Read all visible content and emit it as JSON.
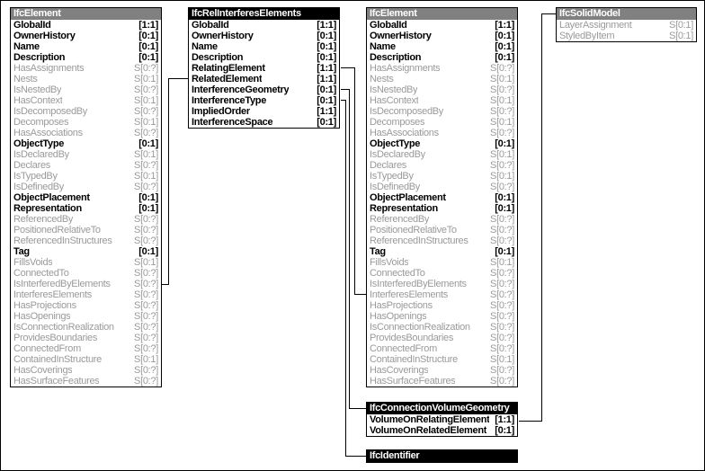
{
  "diagram": {
    "title": "IfcRelInterferesElements EXPRESS-G diagram",
    "cardinality_direct": "[1:1]",
    "colors": {
      "title_supertype": "#808080",
      "title_entity": "#000000",
      "direct_attribute": "#000000",
      "inverse_attribute": "#9a9a9a",
      "line": "#000000",
      "background": "#ffffff"
    }
  },
  "entities": {
    "ifc_element_left": {
      "name": "IfcElement",
      "title_style": "gray",
      "attributes": [
        {
          "name": "GlobalId",
          "card": "[1:1]",
          "kind": "direct"
        },
        {
          "name": "OwnerHistory",
          "card": "[0:1]",
          "kind": "direct"
        },
        {
          "name": "Name",
          "card": "[0:1]",
          "kind": "direct"
        },
        {
          "name": "Description",
          "card": "[0:1]",
          "kind": "direct"
        },
        {
          "name": "HasAssignments",
          "card": "S[0:?]",
          "kind": "inverse"
        },
        {
          "name": "Nests",
          "card": "S[0:1]",
          "kind": "inverse"
        },
        {
          "name": "IsNestedBy",
          "card": "S[0:?]",
          "kind": "inverse"
        },
        {
          "name": "HasContext",
          "card": "S[0:1]",
          "kind": "inverse"
        },
        {
          "name": "IsDecomposedBy",
          "card": "S[0:?]",
          "kind": "inverse"
        },
        {
          "name": "Decomposes",
          "card": "S[0:1]",
          "kind": "inverse"
        },
        {
          "name": "HasAssociations",
          "card": "S[0:?]",
          "kind": "inverse"
        },
        {
          "name": "ObjectType",
          "card": "[0:1]",
          "kind": "direct"
        },
        {
          "name": "IsDeclaredBy",
          "card": "S[0:1]",
          "kind": "inverse"
        },
        {
          "name": "Declares",
          "card": "S[0:?]",
          "kind": "inverse"
        },
        {
          "name": "IsTypedBy",
          "card": "S[0:1]",
          "kind": "inverse"
        },
        {
          "name": "IsDefinedBy",
          "card": "S[0:?]",
          "kind": "inverse"
        },
        {
          "name": "ObjectPlacement",
          "card": "[0:1]",
          "kind": "direct"
        },
        {
          "name": "Representation",
          "card": "[0:1]",
          "kind": "direct"
        },
        {
          "name": "ReferencedBy",
          "card": "S[0:?]",
          "kind": "inverse"
        },
        {
          "name": "PositionedRelativeTo",
          "card": "S[0:?]",
          "kind": "inverse"
        },
        {
          "name": "ReferencedInStructures",
          "card": "S[0:?]",
          "kind": "inverse"
        },
        {
          "name": "Tag",
          "card": "[0:1]",
          "kind": "direct"
        },
        {
          "name": "FillsVoids",
          "card": "S[0:1]",
          "kind": "inverse"
        },
        {
          "name": "ConnectedTo",
          "card": "S[0:?]",
          "kind": "inverse"
        },
        {
          "name": "IsInterferedByElements",
          "card": "S[0:?]",
          "kind": "inverse"
        },
        {
          "name": "InterferesElements",
          "card": "S[0:?]",
          "kind": "inverse"
        },
        {
          "name": "HasProjections",
          "card": "S[0:?]",
          "kind": "inverse"
        },
        {
          "name": "HasOpenings",
          "card": "S[0:?]",
          "kind": "inverse"
        },
        {
          "name": "IsConnectionRealization",
          "card": "S[0:?]",
          "kind": "inverse"
        },
        {
          "name": "ProvidesBoundaries",
          "card": "S[0:?]",
          "kind": "inverse"
        },
        {
          "name": "ConnectedFrom",
          "card": "S[0:?]",
          "kind": "inverse"
        },
        {
          "name": "ContainedInStructure",
          "card": "S[0:1]",
          "kind": "inverse"
        },
        {
          "name": "HasCoverings",
          "card": "S[0:?]",
          "kind": "inverse"
        },
        {
          "name": "HasSurfaceFeatures",
          "card": "S[0:?]",
          "kind": "inverse"
        }
      ]
    },
    "ifc_rel_interferes_elements": {
      "name": "IfcRelInterferesElements",
      "title_style": "black",
      "attributes": [
        {
          "name": "GlobalId",
          "card": "[1:1]",
          "kind": "direct"
        },
        {
          "name": "OwnerHistory",
          "card": "[0:1]",
          "kind": "direct"
        },
        {
          "name": "Name",
          "card": "[0:1]",
          "kind": "direct"
        },
        {
          "name": "Description",
          "card": "[0:1]",
          "kind": "direct"
        },
        {
          "name": "RelatingElement",
          "card": "[1:1]",
          "kind": "direct"
        },
        {
          "name": "RelatedElement",
          "card": "[1:1]",
          "kind": "direct"
        },
        {
          "name": "InterferenceGeometry",
          "card": "[0:1]",
          "kind": "direct"
        },
        {
          "name": "InterferenceType",
          "card": "[0:1]",
          "kind": "direct"
        },
        {
          "name": "ImpliedOrder",
          "card": "[1:1]",
          "kind": "direct"
        },
        {
          "name": "InterferenceSpace",
          "card": "[0:1]",
          "kind": "direct"
        }
      ]
    },
    "ifc_element_right": {
      "name": "IfcElement",
      "title_style": "gray",
      "attributes": [
        {
          "name": "GlobalId",
          "card": "[1:1]",
          "kind": "direct"
        },
        {
          "name": "OwnerHistory",
          "card": "[0:1]",
          "kind": "direct"
        },
        {
          "name": "Name",
          "card": "[0:1]",
          "kind": "direct"
        },
        {
          "name": "Description",
          "card": "[0:1]",
          "kind": "direct"
        },
        {
          "name": "HasAssignments",
          "card": "S[0:?]",
          "kind": "inverse"
        },
        {
          "name": "Nests",
          "card": "S[0:1]",
          "kind": "inverse"
        },
        {
          "name": "IsNestedBy",
          "card": "S[0:?]",
          "kind": "inverse"
        },
        {
          "name": "HasContext",
          "card": "S[0:1]",
          "kind": "inverse"
        },
        {
          "name": "IsDecomposedBy",
          "card": "S[0:?]",
          "kind": "inverse"
        },
        {
          "name": "Decomposes",
          "card": "S[0:1]",
          "kind": "inverse"
        },
        {
          "name": "HasAssociations",
          "card": "S[0:?]",
          "kind": "inverse"
        },
        {
          "name": "ObjectType",
          "card": "[0:1]",
          "kind": "direct"
        },
        {
          "name": "IsDeclaredBy",
          "card": "S[0:1]",
          "kind": "inverse"
        },
        {
          "name": "Declares",
          "card": "S[0:?]",
          "kind": "inverse"
        },
        {
          "name": "IsTypedBy",
          "card": "S[0:1]",
          "kind": "inverse"
        },
        {
          "name": "IsDefinedBy",
          "card": "S[0:?]",
          "kind": "inverse"
        },
        {
          "name": "ObjectPlacement",
          "card": "[0:1]",
          "kind": "direct"
        },
        {
          "name": "Representation",
          "card": "[0:1]",
          "kind": "direct"
        },
        {
          "name": "ReferencedBy",
          "card": "S[0:?]",
          "kind": "inverse"
        },
        {
          "name": "PositionedRelativeTo",
          "card": "S[0:?]",
          "kind": "inverse"
        },
        {
          "name": "ReferencedInStructures",
          "card": "S[0:?]",
          "kind": "inverse"
        },
        {
          "name": "Tag",
          "card": "[0:1]",
          "kind": "direct"
        },
        {
          "name": "FillsVoids",
          "card": "S[0:1]",
          "kind": "inverse"
        },
        {
          "name": "ConnectedTo",
          "card": "S[0:?]",
          "kind": "inverse"
        },
        {
          "name": "IsInterferedByElements",
          "card": "S[0:?]",
          "kind": "inverse"
        },
        {
          "name": "InterferesElements",
          "card": "S[0:?]",
          "kind": "inverse"
        },
        {
          "name": "HasProjections",
          "card": "S[0:?]",
          "kind": "inverse"
        },
        {
          "name": "HasOpenings",
          "card": "S[0:?]",
          "kind": "inverse"
        },
        {
          "name": "IsConnectionRealization",
          "card": "S[0:?]",
          "kind": "inverse"
        },
        {
          "name": "ProvidesBoundaries",
          "card": "S[0:?]",
          "kind": "inverse"
        },
        {
          "name": "ConnectedFrom",
          "card": "S[0:?]",
          "kind": "inverse"
        },
        {
          "name": "ContainedInStructure",
          "card": "S[0:1]",
          "kind": "inverse"
        },
        {
          "name": "HasCoverings",
          "card": "S[0:?]",
          "kind": "inverse"
        },
        {
          "name": "HasSurfaceFeatures",
          "card": "S[0:?]",
          "kind": "inverse"
        }
      ]
    },
    "ifc_solid_model": {
      "name": "IfcSolidModel",
      "title_style": "gray",
      "attributes": [
        {
          "name": "LayerAssignment",
          "card": "S[0:1]",
          "kind": "inverse"
        },
        {
          "name": "StyledByItem",
          "card": "S[0:1]",
          "kind": "inverse"
        }
      ]
    },
    "ifc_connection_volume_geometry": {
      "name": "IfcConnectionVolumeGeometry",
      "title_style": "black",
      "attributes": [
        {
          "name": "VolumeOnRelatingElement",
          "card": "[1:1]",
          "kind": "direct"
        },
        {
          "name": "VolumeOnRelatedElement",
          "card": "[0:1]",
          "kind": "direct"
        }
      ]
    },
    "ifc_identifier": {
      "name": "IfcIdentifier",
      "title_style": "black",
      "attributes": []
    }
  },
  "connections": [
    {
      "from": "RelatingElement",
      "to": "ifc_element_right.InterferesElements"
    },
    {
      "from": "RelatedElement",
      "to": "ifc_element_left.IsInterferedByElements"
    },
    {
      "from": "InterferenceGeometry",
      "to": "ifc_connection_volume_geometry"
    },
    {
      "from": "InterferenceType",
      "to": "ifc_identifier"
    },
    {
      "from": "ifc_solid_model",
      "to": "ifc_connection_volume_geometry.VolumeOnRelatingElement"
    }
  ]
}
